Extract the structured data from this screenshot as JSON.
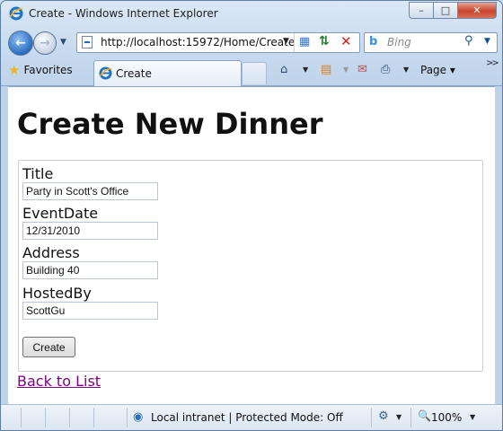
{
  "window": {
    "title": "Create - Windows Internet Explorer",
    "minimize_label": "–",
    "maximize_label": "□",
    "close_label": "✕"
  },
  "navbar": {
    "url": "http://localhost:15972/Home/Create",
    "search_placeholder": "Bing"
  },
  "command_bar": {
    "favorites_label": "Favorites",
    "tab_label": "Create",
    "page_menu_label": "Page",
    "more_label": ">>"
  },
  "page": {
    "heading": "Create New Dinner",
    "fields": [
      {
        "label": "Title",
        "value": "Party in Scott's Office"
      },
      {
        "label": "EventDate",
        "value": "12/31/2010"
      },
      {
        "label": "Address",
        "value": "Building 40"
      },
      {
        "label": "HostedBy",
        "value": "ScottGu"
      }
    ],
    "submit_label": "Create",
    "back_link": "Back to List"
  },
  "status_bar": {
    "zone": "Local intranet | Protected Mode: Off",
    "zoom": "100%"
  },
  "icons": [
    "ie-logo-icon",
    "back-arrow-icon",
    "forward-arrow-icon",
    "page-icon",
    "compatibility-icon",
    "refresh-icon",
    "stop-icon",
    "bing-icon",
    "search-icon",
    "star-icon",
    "home-icon",
    "rss-icon",
    "mail-icon",
    "print-icon",
    "globe-icon",
    "zoom-icon"
  ]
}
